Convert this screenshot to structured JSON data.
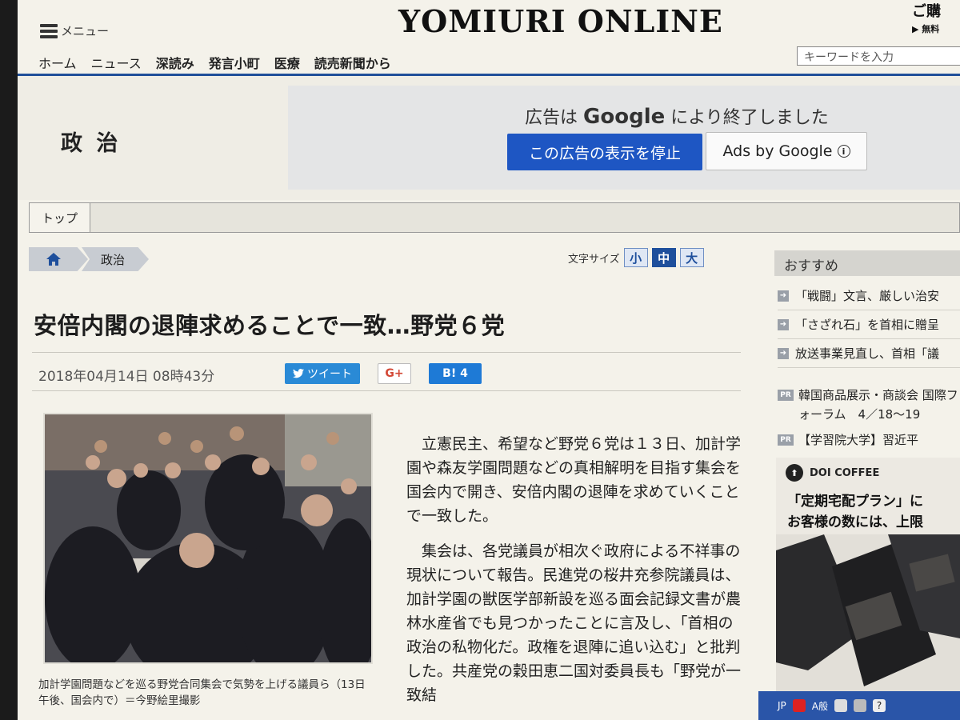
{
  "header": {
    "menu_label": "メニュー",
    "logo": "YOMIURI ONLINE",
    "subscribe_label": "ご購",
    "subscribe_sub": "▶ 無料",
    "search_placeholder": "キーワードを入力"
  },
  "nav": {
    "items": [
      "ホーム",
      "ニュース",
      "深読み",
      "発言小町",
      "医療",
      "読売新聞から"
    ]
  },
  "section": {
    "title": "政 治",
    "tab_top": "トップ"
  },
  "ad": {
    "closed_prefix": "広告は",
    "closed_brand": "Google",
    "closed_suffix": "により終了しました",
    "stop_button": "この広告の表示を停止",
    "ads_by": "Ads by Google"
  },
  "breadcrumb": {
    "section": "政治"
  },
  "font_size": {
    "label": "文字サイズ",
    "small": "小",
    "medium": "中",
    "large": "大",
    "selected": "中"
  },
  "article": {
    "headline": "安倍内閣の退陣求めることで一致…野党６党",
    "date": "2018年04月14日 08時43分",
    "tweet_label": "ツイート",
    "gplus_label": "G+",
    "hatena_label": "B! 4",
    "caption": "加計学園問題などを巡る野党合同集会で気勢を上げる議員ら（13日午後、国会内で）＝今野絵里撮影",
    "paragraphs": [
      "立憲民主、希望など野党６党は１３日、加計学園や森友学園問題などの真相解明を目指す集会を国会内で開き、安倍内閣の退陣を求めていくことで一致した。",
      "集会は、各党議員が相次ぐ政府による不祥事の現状について報告。民進党の桜井充参院議員は、加計学園の獣医学部新設を巡る面会記録文書が農林水産省でも見つかったことに言及し、「首相の政治の私物化だ。政権を退陣に追い込む」と批判した。共産党の穀田恵二国対委員長も「野党が一致結"
    ]
  },
  "sidebar": {
    "recommend_title": "おすすめ",
    "recommend_items": [
      "「戦闘」文言、厳しい治安",
      "「さざれ石」を首相に贈呈",
      "放送事業見直し、首相「議"
    ],
    "pr_items": [
      "韓国商品展示・商談会 国際フォーラム　4／18〜19",
      "【学習院大学】習近平"
    ],
    "coffee_ad": {
      "brand": "DOI COFFEE",
      "line1": "「定期宅配プラン」に",
      "line2": "お客様の数には、上限"
    }
  },
  "taskbar": {
    "lang": "JP",
    "ime": "A般"
  }
}
